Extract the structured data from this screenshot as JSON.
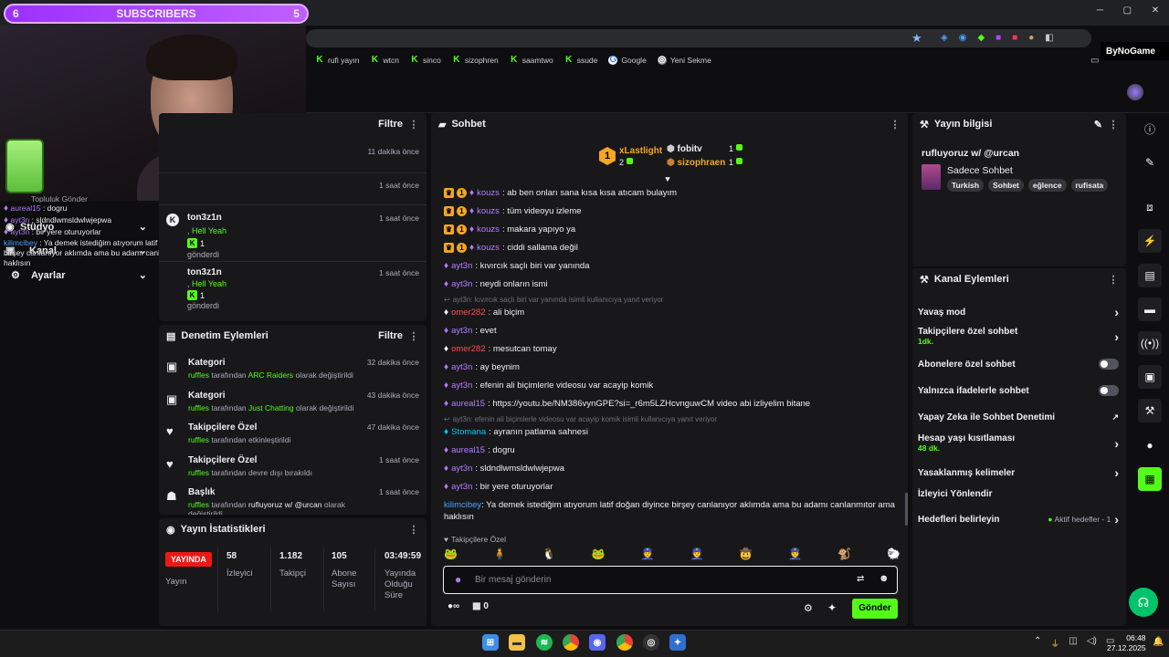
{
  "overlay": {
    "sub_left": "6",
    "sub_title": "SUBSCRIBERS",
    "sub_right": "5"
  },
  "browser": {
    "bookmarks": [
      "rufi yayın",
      "wtcn",
      "sinco",
      "sizophren",
      "saamtwo",
      "ssude",
      "Google",
      "Yeni Sekme"
    ],
    "profile": "ByNoGame"
  },
  "cam_chat": [
    {
      "user": "aureal15",
      "text": "dogru"
    },
    {
      "user": "ayt3n",
      "text": "sldndlwmsldwlwjepwa"
    },
    {
      "user": "ayt3n",
      "text": "bir yere oturuyorlar"
    },
    {
      "user": "kilimcibey",
      "text": "Ya demek istediğim atıyorum latif doğan diyince birşey canlanıyor aklımda ama bu adamı canlanmıtor ama haklısın"
    }
  ],
  "left_nav": {
    "stream": "Stüdyo",
    "kanal": "Kanal",
    "ayarlar": "Ayarlar",
    "ghost": "Topluluk Gönder"
  },
  "activity": {
    "filter": "Filtre",
    "items": [
      {
        "time": "11 dakika önce"
      },
      {
        "time": "1 saat önce"
      },
      {
        "user": "ton3z1n",
        "sub": ", Hell Yeah",
        "count": "1",
        "sent": "gönderdi",
        "time": "1 saat önce"
      },
      {
        "user": "ton3z1n",
        "sub": ", Hell Yeah",
        "count": "1",
        "sent": "gönderdi",
        "time": "1 saat önce"
      }
    ]
  },
  "audit": {
    "title": "Denetim Eylemleri",
    "filter": "Filtre",
    "items": [
      {
        "icon": "category-icon",
        "title": "Kategori",
        "actor": "ruffles",
        "mid": "tarafından",
        "target": "ARC Raiders",
        "end": "olarak değiştirildi",
        "time": "32 dakika önce"
      },
      {
        "icon": "category-icon",
        "title": "Kategori",
        "actor": "ruffles",
        "mid": "tarafından",
        "target": "Just Chatting",
        "end": "olarak değiştirildi",
        "time": "43 dakika önce"
      },
      {
        "icon": "heart-icon",
        "title": "Takipçilere Özel",
        "actor": "ruffles",
        "mid": "tarafından etkinleştirildi",
        "target": "",
        "end": "",
        "time": "47 dakika önce"
      },
      {
        "icon": "heart-icon",
        "title": "Takipçilere Özel",
        "actor": "ruffles",
        "mid": "tarafından devre dışı bırakıldı",
        "target": "",
        "end": "",
        "time": "1 saat önce"
      },
      {
        "icon": "user-edit-icon",
        "title": "Başlık",
        "actor": "ruffles",
        "mid": "tarafından",
        "target": "rufluyoruz w/ @urcan",
        "end": "olarak değiştirildi",
        "time": "1 saat önce"
      }
    ]
  },
  "stats": {
    "title": "Yayın İstatistikleri",
    "live": "YAYINDA",
    "live_label": "Yayın",
    "items": [
      {
        "v": "58",
        "l": "İzleyici"
      },
      {
        "v": "1.182",
        "l": "Takipçi"
      },
      {
        "v": "105",
        "l": "Abone Sayısı"
      },
      {
        "v": "03:49:59",
        "l": "Yayında Olduğu Süre"
      }
    ]
  },
  "chat": {
    "title": "Sohbet",
    "leader": {
      "rank": "1",
      "name": "xLastlight",
      "score": "2",
      "second": "fobitv",
      "second_score": "1",
      "third": "sizophraen",
      "third_score": "1"
    },
    "messages": [
      {
        "u": "kouzs",
        "c": "#b57cff",
        "t": ": ab ben onları sana kısa kısa atıcam bulayım",
        "crown": true
      },
      {
        "u": "kouzs",
        "c": "#b57cff",
        "t": ": tüm videoyu izleme",
        "crown": true
      },
      {
        "u": "kouzs",
        "c": "#b57cff",
        "t": ": makara yapıyo ya",
        "crown": true
      },
      {
        "u": "kouzs",
        "c": "#b57cff",
        "t": ": ciddi sallama değil",
        "crown": true
      },
      {
        "u": "ayt3n",
        "c": "#b57cff",
        "t": ": kıvırcık saçlı biri var yanında"
      },
      {
        "u": "ayt3n",
        "c": "#b57cff",
        "t": ": neydi onların ismi"
      },
      {
        "reply": "ayt3n: kıvırcık saçlı biri var yanında isimli kullanıcıya yanıt veriyor"
      },
      {
        "u": "omer282",
        "c": "#ff4d4d",
        "t": ": ali biçim"
      },
      {
        "u": "ayt3n",
        "c": "#b57cff",
        "t": ": evet"
      },
      {
        "u": "omer282",
        "c": "#ff4d4d",
        "t": ": mesutcan tomay"
      },
      {
        "u": "ayt3n",
        "c": "#b57cff",
        "t": ": ay beynim"
      },
      {
        "u": "ayt3n",
        "c": "#b57cff",
        "t": ": efenin ali biçimlerle videosu var acayip komik"
      },
      {
        "u": "aureal15",
        "c": "#b57cff",
        "t": ": https://youtu.be/NM386vynGPE?si=_r6m5LZHcvnguwCM video abi izliyelim bitane"
      },
      {
        "reply": "ayt3n: efenin ali biçimlerle videosu var acayip komik isimli kullanıcıya yanıt veriyor"
      },
      {
        "u": "Stomana",
        "c": "#00c8ff",
        "t": ": ayranın patlama sahnesi"
      },
      {
        "u": "aureal15",
        "c": "#b57cff",
        "t": ": dogru"
      },
      {
        "u": "ayt3n",
        "c": "#b57cff",
        "t": ": sldndlwmsldwlwjepwa"
      },
      {
        "u": "ayt3n",
        "c": "#b57cff",
        "t": ": bir yere oturuyorlar"
      }
    ],
    "last_user": "kilimcibey",
    "last_text": ": Ya demek istediğim atıyorum latif doğan diyince birşey canlanıyor aklımda ama bu adamı canlanmıtor ama haklısın",
    "followers_only": "Takipçilere Özel",
    "placeholder": "Bir mesaj gönderin",
    "points": "0",
    "send": "Gönder"
  },
  "stream_info": {
    "title_label": "Yayın bilgisi",
    "stream_title": "rufluyoruz w/ @urcan",
    "category": "Sadece Sohbet",
    "tags": [
      "Turkish",
      "Sohbet",
      "eğlence",
      "rufisata"
    ]
  },
  "channel_actions": {
    "title": "Kanal Eylemleri",
    "items": [
      {
        "label": "Yavaş mod",
        "sub": "",
        "ctl": "chevron"
      },
      {
        "label": "Takipçilere özel sohbet",
        "sub": "1dk.",
        "ctl": "chevron"
      },
      {
        "label": "Abonelere özel sohbet",
        "sub": "",
        "ctl": "toggle"
      },
      {
        "label": "Yalnızca ifadelerle sohbet",
        "sub": "",
        "ctl": "toggle"
      },
      {
        "label": "Yapay Zeka ile Sohbet Denetimi",
        "sub": "",
        "ctl": "external"
      },
      {
        "label": "Hesap yaşı kısıtlaması",
        "sub": "48 dk.",
        "ctl": "chevron"
      },
      {
        "label": "Yasaklanmış kelimeler",
        "sub": "",
        "ctl": "chevron"
      },
      {
        "label": "İzleyici Yönlendir",
        "sub": "",
        "ctl": "none"
      },
      {
        "label": "Hedefleri belirleyin",
        "sub": "",
        "ctl": "goals",
        "extra": "Aktif hedefler - 1"
      }
    ]
  },
  "taskbar": {
    "time": "06:48",
    "date": "27.12.2025"
  }
}
